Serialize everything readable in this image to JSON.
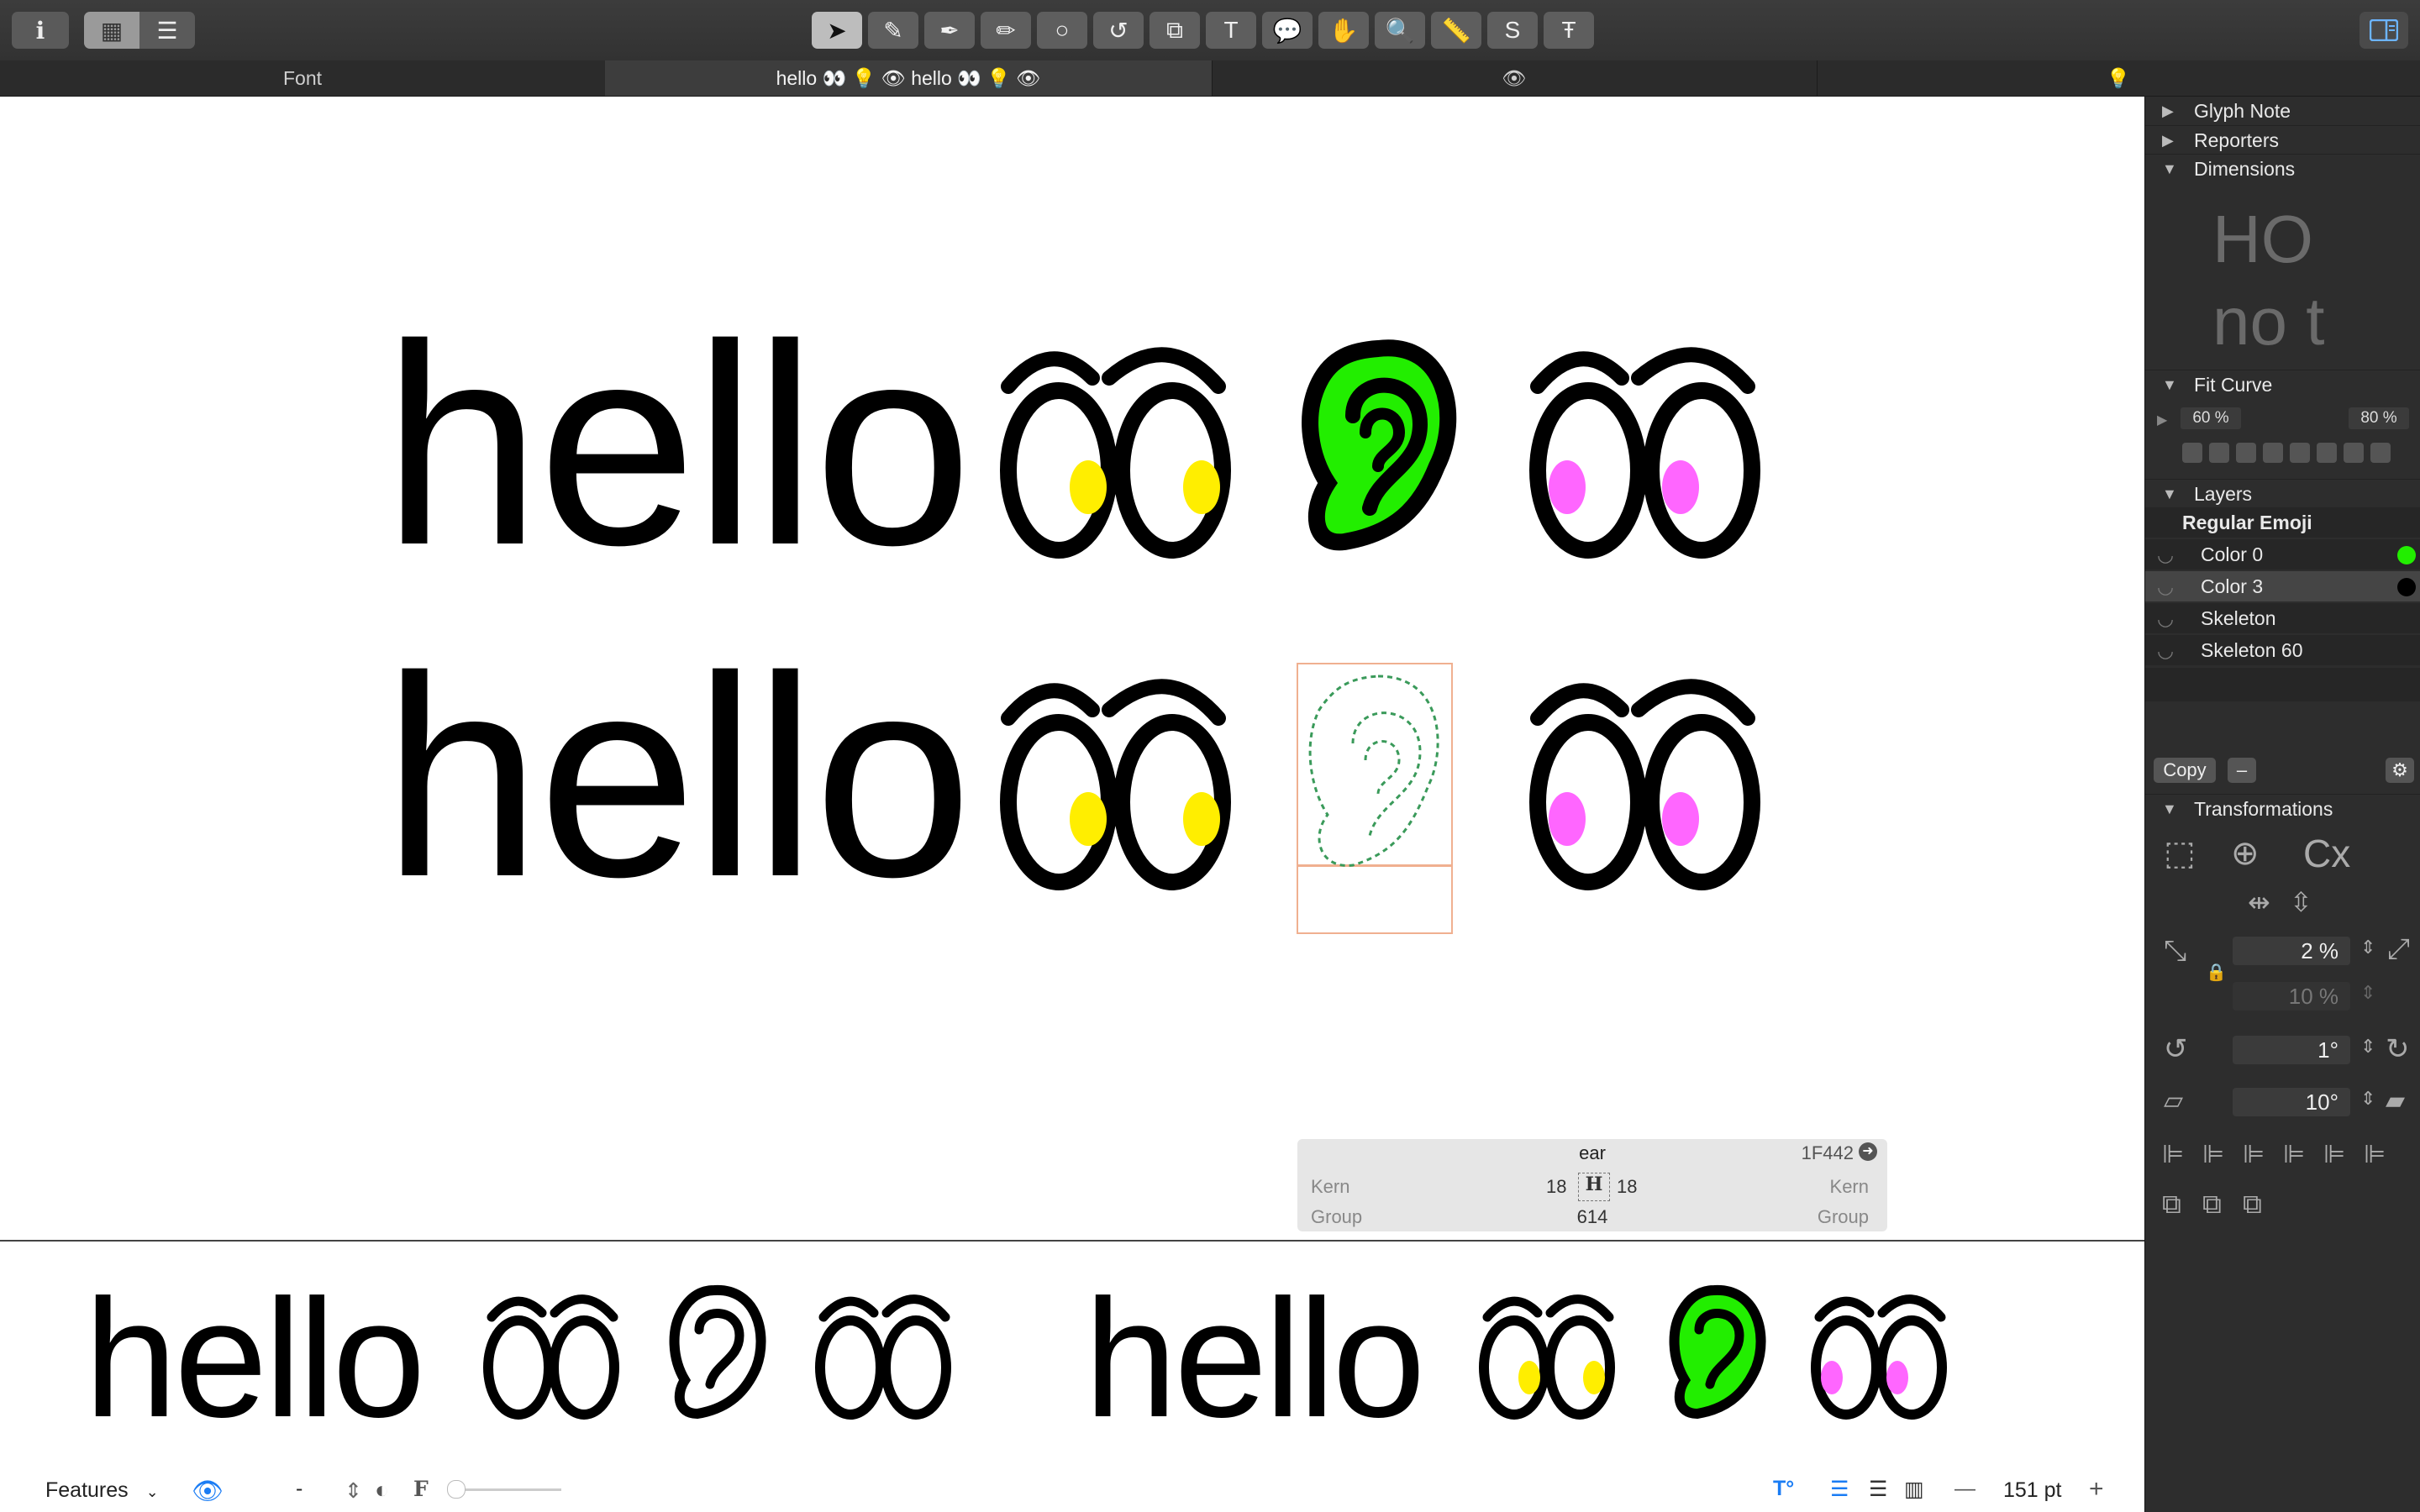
{
  "toolbar": {
    "left_buttons": [
      {
        "name": "info-button",
        "icon": "info-icon",
        "glyph": "i"
      },
      {
        "name": "grid-view-button",
        "icon": "grid-icon",
        "glyph": "▦"
      },
      {
        "name": "list-view-button",
        "icon": "list-icon",
        "glyph": "☰"
      }
    ],
    "tools": [
      {
        "name": "select-tool",
        "icon": "arrow-cursor-icon",
        "glyph": "➤",
        "selected": true
      },
      {
        "name": "draw-tool",
        "icon": "pen-nib-icon",
        "glyph": "✎"
      },
      {
        "name": "pen-tool",
        "icon": "pen-icon",
        "glyph": "✒"
      },
      {
        "name": "pencil-tool",
        "icon": "pencil-icon",
        "glyph": "✏"
      },
      {
        "name": "shape-tool",
        "icon": "circle-icon",
        "glyph": "○"
      },
      {
        "name": "rotate-tool",
        "icon": "rotate-icon",
        "glyph": "↺"
      },
      {
        "name": "scale-tool",
        "icon": "scale-icon",
        "glyph": "⧉"
      },
      {
        "name": "text-tool",
        "icon": "text-icon",
        "glyph": "T"
      },
      {
        "name": "annotation-tool",
        "icon": "speech-bubble-icon",
        "glyph": "💬"
      },
      {
        "name": "hand-tool",
        "icon": "hand-icon",
        "glyph": "✋"
      },
      {
        "name": "zoom-tool",
        "icon": "magnifier-icon",
        "glyph": "🔍"
      },
      {
        "name": "measure-tool",
        "icon": "ruler-icon",
        "glyph": "📏"
      },
      {
        "name": "export-tool",
        "icon": "export-s-icon",
        "glyph": "S"
      },
      {
        "name": "font-info-tool",
        "icon": "font-info-icon",
        "glyph": "Ŧ"
      }
    ],
    "right_button": {
      "name": "sidebar-toggle-button",
      "icon": "sidebar-icon"
    }
  },
  "tabs": [
    {
      "label": "Font",
      "active": false
    },
    {
      "label": "hello 👀 💡 👁  hello 👀 💡 👁",
      "active": true
    },
    {
      "label": "👁",
      "active": false
    },
    {
      "label": "💡",
      "active": false
    }
  ],
  "canvas": {
    "line1_text": "hello",
    "line2_text": "hello",
    "colors": {
      "ear_fill": "#22ee00",
      "eye_left_pupil": "#ffee00",
      "eye_right_pupil": "#ff66ff",
      "selection": "#f0b090"
    }
  },
  "infobox": {
    "glyph_name": "ear",
    "unicode": "1F442",
    "kern_left_label": "Kern",
    "kern_left_value": "18",
    "kern_right_value": "18",
    "kern_right_label": "Kern",
    "group_left_label": "Group",
    "width_value": "614",
    "group_right_label": "Group"
  },
  "preview": {
    "text_left": "hello",
    "text_right": "hello"
  },
  "bottombar": {
    "features_label": "Features",
    "dash": "-",
    "zoom_value": "151 pt"
  },
  "sidebar": {
    "sections": {
      "glyph_note": "Glyph Note",
      "reporters": "Reporters",
      "dimensions": "Dimensions",
      "fit_curve": "Fit Curve",
      "layers": "Layers",
      "transformations": "Transformations"
    },
    "dimensions_preview": {
      "line1": "HO",
      "line2": "no t"
    },
    "fit_curve": {
      "min": "60 %",
      "max": "80 %"
    },
    "layers": {
      "master": "Regular Emoji",
      "items": [
        {
          "label": "Color 0",
          "swatch": "#22ee00"
        },
        {
          "label": "Color 3",
          "swatch": "#000000"
        },
        {
          "label": "Skeleton",
          "swatch": ""
        },
        {
          "label": "Skeleton 60",
          "swatch": ""
        }
      ]
    },
    "copy_label": "Copy",
    "minus_label": "–",
    "transform": {
      "scale_x": "2 %",
      "scale_y": "10 %",
      "rotate": "1°",
      "slant": "10°",
      "cx_label": "Cx"
    }
  }
}
